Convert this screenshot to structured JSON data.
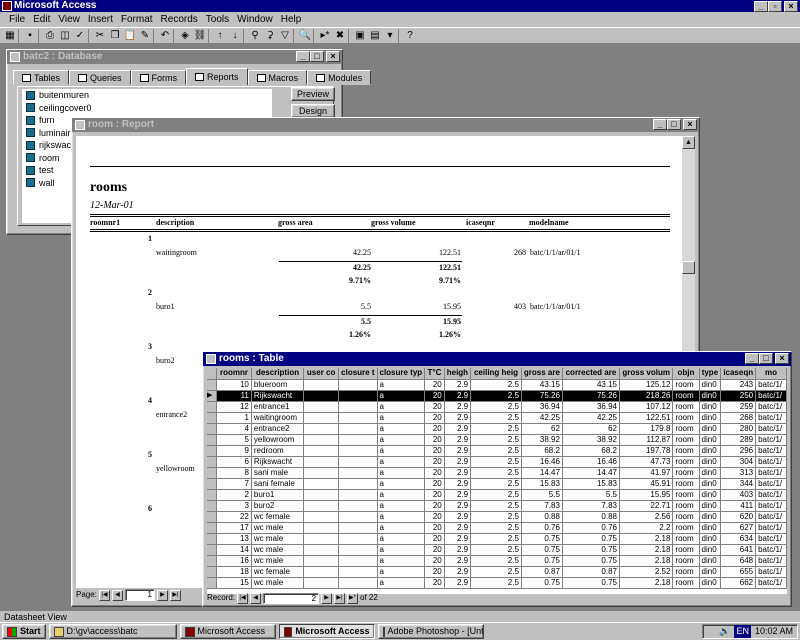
{
  "app": {
    "title": "Microsoft Access",
    "status": "Datasheet View"
  },
  "menu": [
    "File",
    "Edit",
    "View",
    "Insert",
    "Format",
    "Records",
    "Tools",
    "Window",
    "Help"
  ],
  "db_window": {
    "title": "batc2 : Database",
    "tabs": [
      "Tables",
      "Queries",
      "Forms",
      "Reports",
      "Macros",
      "Modules"
    ],
    "active_tab": "Reports",
    "items": [
      "buitenmuren",
      "ceilingcover0",
      "furn",
      "luminaire",
      "rijkswacht",
      "room",
      "test",
      "wall"
    ],
    "buttons": [
      "Preview",
      "Design"
    ]
  },
  "report_window": {
    "title": "room : Report",
    "report_title": "rooms",
    "date": "12-Mar-01",
    "columns": [
      "roomnr1",
      "description",
      "gross area",
      "gross volume",
      "icaseqnr",
      "modelname"
    ],
    "groups": [
      {
        "nr": "1",
        "description": "waitingroom",
        "gross_area": "42.25",
        "gross_volume": "122.51",
        "icaseqnr": "268",
        "modelname": "batc/1/1/ar/01/1",
        "sum_area": "42.25",
        "sum_volume": "122.51",
        "pct_area": "9.71%",
        "pct_volume": "9.71%"
      },
      {
        "nr": "2",
        "description": "buro1",
        "gross_area": "5.5",
        "gross_volume": "15.95",
        "icaseqnr": "403",
        "modelname": "batc/1/1/ar/01/1",
        "sum_area": "5.5",
        "sum_volume": "15.95",
        "pct_area": "1.26%",
        "pct_volume": "1.26%"
      },
      {
        "nr": "3",
        "description": "buro2",
        "gross_area": "7.83",
        "gross_volume": "22.71",
        "icaseqnr": "411",
        "modelname": "batc/1/1/ar/01/1"
      },
      {
        "nr": "4",
        "description": "entrance2"
      },
      {
        "nr": "5",
        "description": "yellowroom"
      },
      {
        "nr": "6"
      }
    ],
    "page_label": "Page:",
    "page_value": "1"
  },
  "table_window": {
    "title": "rooms : Table",
    "columns": [
      "roomnr",
      "description",
      "user co",
      "closure t",
      "closure typ",
      "T°C",
      "heigh",
      "ceiling heig",
      "gross are",
      "corrected are",
      "gross volum",
      "objn",
      "type",
      "icaseqn",
      "mo"
    ],
    "rows": [
      [
        "10",
        "blueroom",
        "",
        "",
        "a",
        "20",
        "2.9",
        "2.5",
        "43.15",
        "43.15",
        "125.12",
        "room",
        "din0",
        "243",
        "batc/1/"
      ],
      [
        "11",
        "Rijkswacht",
        "",
        "",
        "a",
        "20",
        "2.9",
        "2.5",
        "75.26",
        "75.26",
        "218.26",
        "room",
        "din0",
        "250",
        "batc/1/"
      ],
      [
        "12",
        "entrance1",
        "",
        "",
        "a",
        "20",
        "2.9",
        "2.5",
        "36.94",
        "36.94",
        "107.12",
        "room",
        "din0",
        "259",
        "batc/1/"
      ],
      [
        "1",
        "waitingroom",
        "",
        "",
        "a",
        "20",
        "2.9",
        "2.5",
        "42.25",
        "42.25",
        "122.51",
        "room",
        "din0",
        "268",
        "batc/1/"
      ],
      [
        "4",
        "entrance2",
        "",
        "",
        "a",
        "20",
        "2.9",
        "2.5",
        "62",
        "62",
        "179.8",
        "room",
        "din0",
        "280",
        "batc/1/"
      ],
      [
        "5",
        "yellowroom",
        "",
        "",
        "a",
        "20",
        "2.9",
        "2.5",
        "38.92",
        "38.92",
        "112.87",
        "room",
        "din0",
        "289",
        "batc/1/"
      ],
      [
        "9",
        "redroom",
        "",
        "",
        "a",
        "20",
        "2.9",
        "2.5",
        "68.2",
        "68.2",
        "197.78",
        "room",
        "din0",
        "296",
        "batc/1/"
      ],
      [
        "6",
        "Rijkswacht",
        "",
        "",
        "a",
        "20",
        "2.9",
        "2.5",
        "16.46",
        "16.46",
        "47.73",
        "room",
        "din0",
        "304",
        "batc/1/"
      ],
      [
        "8",
        "sani male",
        "",
        "",
        "a",
        "20",
        "2.9",
        "2.5",
        "14.47",
        "14.47",
        "41.97",
        "room",
        "din0",
        "313",
        "batc/1/"
      ],
      [
        "7",
        "sani female",
        "",
        "",
        "a",
        "20",
        "2.9",
        "2.5",
        "15.83",
        "15.83",
        "45.91",
        "room",
        "din0",
        "344",
        "batc/1/"
      ],
      [
        "2",
        "buro1",
        "",
        "",
        "a",
        "20",
        "2.9",
        "2.5",
        "5.5",
        "5.5",
        "15.95",
        "room",
        "din0",
        "403",
        "batc/1/"
      ],
      [
        "3",
        "buro2",
        "",
        "",
        "a",
        "20",
        "2.9",
        "2.5",
        "7.83",
        "7.83",
        "22.71",
        "room",
        "din0",
        "411",
        "batc/1/"
      ],
      [
        "22",
        "wc female",
        "",
        "",
        "a",
        "20",
        "2.9",
        "2.5",
        "0.88",
        "0.88",
        "2.56",
        "room",
        "din0",
        "620",
        "batc/1/"
      ],
      [
        "17",
        "wc male",
        "",
        "",
        "a",
        "20",
        "2.9",
        "2.5",
        "0.76",
        "0.76",
        "2.2",
        "room",
        "din0",
        "627",
        "batc/1/"
      ],
      [
        "13",
        "wc male",
        "",
        "",
        "a",
        "20",
        "2.9",
        "2.5",
        "0.75",
        "0.75",
        "2.18",
        "room",
        "din0",
        "634",
        "batc/1/"
      ],
      [
        "14",
        "wc male",
        "",
        "",
        "a",
        "20",
        "2.9",
        "2.5",
        "0.75",
        "0.75",
        "2.18",
        "room",
        "din0",
        "641",
        "batc/1/"
      ],
      [
        "16",
        "wc male",
        "",
        "",
        "a",
        "20",
        "2.9",
        "2.5",
        "0.75",
        "0.75",
        "2.18",
        "room",
        "din0",
        "648",
        "batc/1/"
      ],
      [
        "18",
        "wc female",
        "",
        "",
        "a",
        "20",
        "2.9",
        "2.5",
        "0.87",
        "0.87",
        "2.52",
        "room",
        "din0",
        "655",
        "batc/1/"
      ],
      [
        "15",
        "wc male",
        "",
        "",
        "a",
        "20",
        "2.9",
        "2.5",
        "0.75",
        "0.75",
        "2.18",
        "room",
        "din0",
        "662",
        "batc/1/"
      ]
    ],
    "current_row": 1,
    "record_label": "Record:",
    "record_value": "2",
    "record_of": "of  22"
  },
  "taskbar": {
    "start": "Start",
    "items": [
      "D:\\gv\\access\\batc",
      "Microsoft Access",
      "Microsoft Access",
      "Adobe Photoshop - [Untitle..."
    ],
    "active_index": 2,
    "lang": "EN",
    "clock": "10:02 AM"
  }
}
